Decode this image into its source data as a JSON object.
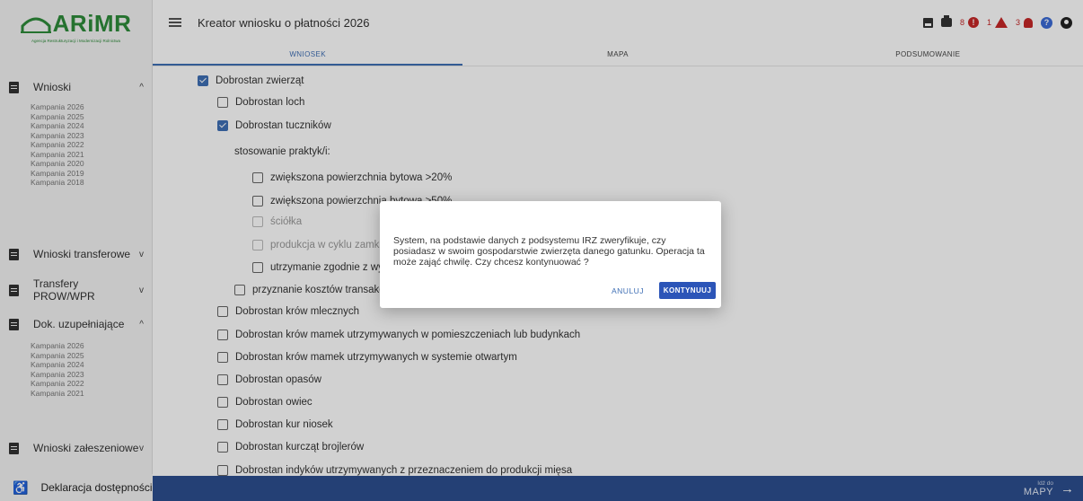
{
  "app": {
    "logo_text": "ARiMR",
    "logo_subtitle": "Agencja Restrukturyzacji i Modernizacji Rolnictwa",
    "title": "Kreator wniosku o płatności 2026"
  },
  "toolbar": {
    "error_count": "8",
    "warning_count": "1",
    "notification_count": "3"
  },
  "tabs": [
    {
      "label": "WNIOSEK",
      "active": true
    },
    {
      "label": "MAPA",
      "active": false
    },
    {
      "label": "PODSUMOWANIE",
      "active": false
    }
  ],
  "sidebar": {
    "sections": [
      {
        "label": "Wnioski",
        "chevron": "^",
        "items": [
          "Kampania 2026",
          "Kampania 2025",
          "Kampania 2024",
          "Kampania 2023",
          "Kampania 2022",
          "Kampania 2021",
          "Kampania 2020",
          "Kampania 2019",
          "Kampania 2018"
        ]
      },
      {
        "label": "Wnioski transferowe",
        "chevron": "v",
        "items": []
      },
      {
        "label": "Transfery PROW/WPR",
        "chevron": "v",
        "items": []
      },
      {
        "label": "Dok. uzupełniające",
        "chevron": "^",
        "items": [
          "Kampania 2026",
          "Kampania 2025",
          "Kampania 2024",
          "Kampania 2023",
          "Kampania 2022",
          "Kampania 2021"
        ]
      },
      {
        "label": "Wnioski załeszeniowe",
        "chevron": "v",
        "items": []
      }
    ],
    "bottom_label": "Deklaracja dostępności"
  },
  "form": {
    "items": [
      {
        "label": "Dobrostan zwierząt",
        "checked": true
      },
      {
        "label": "Dobrostan loch",
        "checked": false
      },
      {
        "label": "Dobrostan tuczników",
        "checked": true
      },
      {
        "label": "stosowanie praktyk/i:"
      },
      {
        "label": "zwiększona powierzchnia bytowa >20%",
        "checked": false
      },
      {
        "label": "zwiększona powierzchnia bytowa >50%",
        "checked": false
      },
      {
        "label": "ściółka",
        "checked": false,
        "disabled": true
      },
      {
        "label": "produkcja w cyklu zamkniętym",
        "checked": false,
        "disabled": true
      },
      {
        "label": "utrzymanie zgodnie z wymaganiami",
        "checked": false
      },
      {
        "label": "przyznanie kosztów transakcyjnych",
        "checked": false
      },
      {
        "label": "Dobrostan krów mlecznych",
        "checked": false
      },
      {
        "label": "Dobrostan krów mamek utrzymywanych w pomieszczeniach lub budynkach",
        "checked": false
      },
      {
        "label": "Dobrostan krów mamek utrzymywanych w systemie otwartym",
        "checked": false
      },
      {
        "label": "Dobrostan opasów",
        "checked": false
      },
      {
        "label": "Dobrostan owiec",
        "checked": false
      },
      {
        "label": "Dobrostan kur niosek",
        "checked": false
      },
      {
        "label": "Dobrostan kurcząt brojlerów",
        "checked": false
      },
      {
        "label": "Dobrostan indyków utrzymywanych z przeznaczeniem do produkcji mięsa",
        "checked": false
      }
    ]
  },
  "dialog": {
    "message": "System, na podstawie danych z podsystemu IRZ zweryfikuje, czy posiadasz w swoim gospodarstwie zwierzęta danego gatunku. Operacja ta może zająć chwilę. Czy chcesz kontynuować ?",
    "cancel_label": "ANULUJ",
    "confirm_label": "KONTYNUUJ"
  },
  "footer": {
    "next_small": "Idź do",
    "next_big": "MAPY",
    "arrow": "→"
  }
}
